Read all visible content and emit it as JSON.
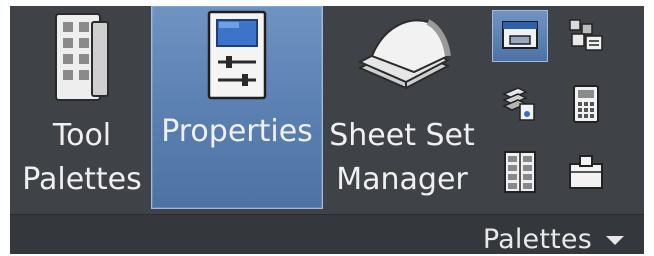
{
  "ribbon": {
    "panel_title": "Palettes",
    "buttons": {
      "tool_palettes": {
        "label": "Tool\nPalettes",
        "icon": "tool-palettes-icon"
      },
      "properties": {
        "label": "Properties",
        "icon": "properties-icon",
        "active": true
      },
      "sheet_set_manager": {
        "label": "Sheet Set\nManager",
        "icon": "sheet-set-manager-icon"
      }
    },
    "small_buttons": [
      {
        "icon": "design-center-icon",
        "active": true
      },
      {
        "icon": "markup-set-manager-icon"
      },
      {
        "icon": "layer-properties-icon"
      },
      {
        "icon": "quick-calc-icon"
      },
      {
        "icon": "external-references-icon"
      },
      {
        "icon": "dbconnect-icon"
      }
    ]
  },
  "colors": {
    "panel_bg": "#3f4247",
    "active_blue": "#5b80b2",
    "text": "#f0f0f0"
  }
}
